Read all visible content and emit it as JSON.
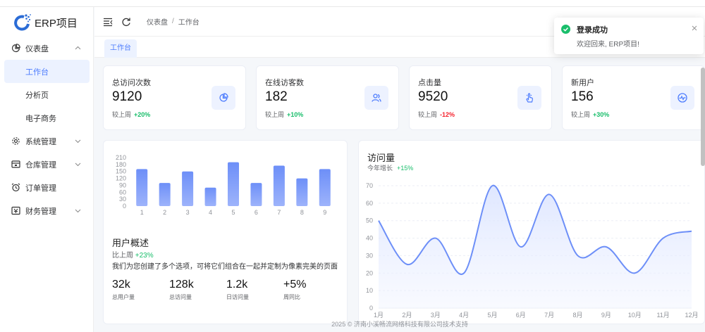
{
  "app": {
    "name": "ERP项目"
  },
  "sidebar": {
    "items": [
      {
        "label": "仪表盘",
        "icon": "dashboard-icon",
        "expanded": true,
        "children": [
          {
            "label": "工作台",
            "active": true
          },
          {
            "label": "分析页"
          },
          {
            "label": "电子商务"
          }
        ]
      },
      {
        "label": "系统管理",
        "icon": "gear-icon"
      },
      {
        "label": "仓库管理",
        "icon": "warehouse-icon"
      },
      {
        "label": "订单管理",
        "icon": "alarm-clock-icon"
      },
      {
        "label": "财务管理",
        "icon": "finance-icon"
      }
    ]
  },
  "header": {
    "breadcrumb": [
      "仪表盘",
      "工作台"
    ],
    "breadcrumb_sep": "/"
  },
  "tabs": [
    {
      "label": "工作台",
      "active": true
    }
  ],
  "stats": [
    {
      "title": "总访问次数",
      "value": "9120",
      "cmp_label": "较上周",
      "change": "+20%",
      "trend": "up",
      "icon": "pie-chart-icon"
    },
    {
      "title": "在线访客数",
      "value": "182",
      "cmp_label": "较上周",
      "change": "+10%",
      "trend": "up",
      "icon": "users-icon"
    },
    {
      "title": "点击量",
      "value": "9520",
      "cmp_label": "较上周",
      "change": "-12%",
      "trend": "down",
      "icon": "pointer-click-icon"
    },
    {
      "title": "新用户",
      "value": "156",
      "cmp_label": "较上周",
      "change": "+30%",
      "trend": "up",
      "icon": "pulse-icon"
    }
  ],
  "overview": {
    "title": "用户概述",
    "cmp_label": "比上周",
    "cmp_change": "+23%",
    "description": "我们为您创建了多个选项，可将它们组合在一起并定制为像素完美的页面",
    "kpis": [
      {
        "value": "32k",
        "label": "总用户量"
      },
      {
        "value": "128k",
        "label": "总访问量"
      },
      {
        "value": "1.2k",
        "label": "日访问量"
      },
      {
        "value": "+5%",
        "label": "周同比"
      }
    ]
  },
  "visits_card": {
    "title": "访问量",
    "sub_label": "今年增长",
    "sub_change": "+15%"
  },
  "footer": {
    "text": "2025 © 济南小溪畅流网络科技有限公司技术支持"
  },
  "toast": {
    "title": "登录成功",
    "message": "欢迎回来, ERP项目!"
  },
  "colors": {
    "accent": "#4d7cfe",
    "success": "#19be6b",
    "danger": "#f5222d",
    "bar": "#6d8ff8"
  },
  "chart_data": [
    {
      "type": "bar",
      "categories": [
        "1",
        "2",
        "3",
        "4",
        "5",
        "6",
        "7",
        "8",
        "9"
      ],
      "values": [
        160,
        100,
        150,
        80,
        190,
        100,
        175,
        120,
        160
      ],
      "yticks": [
        "210",
        "180",
        "150",
        "120",
        "90",
        "60",
        "30",
        "0"
      ],
      "ylim": [
        0,
        210
      ]
    },
    {
      "type": "area",
      "categories": [
        "1月",
        "2月",
        "3月",
        "4月",
        "5月",
        "6月",
        "7月",
        "8月",
        "9月",
        "10月",
        "11月",
        "12月"
      ],
      "values": [
        50,
        25,
        40,
        20,
        70,
        35,
        65,
        30,
        35,
        20,
        40,
        44
      ],
      "yticks": [
        "70",
        "60",
        "50",
        "40",
        "30",
        "20",
        "10",
        "0"
      ],
      "ylim": [
        0,
        70
      ],
      "grid": true
    }
  ]
}
